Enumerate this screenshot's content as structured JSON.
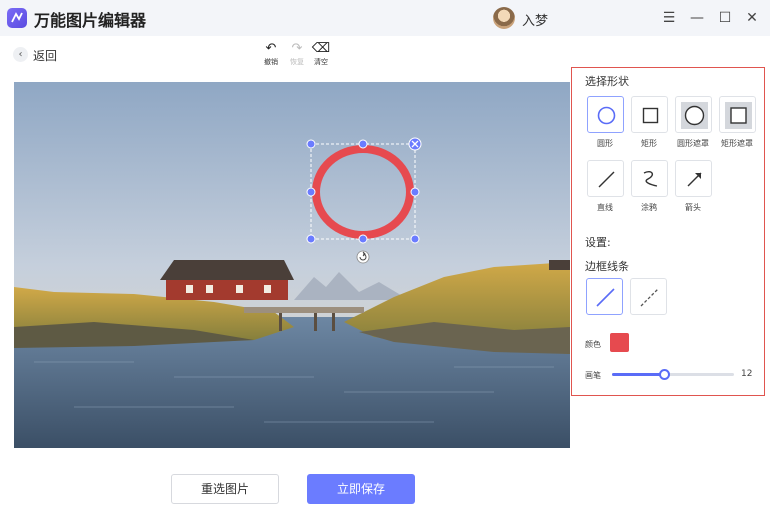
{
  "app": {
    "title": "万能图片编辑器",
    "username": "入梦"
  },
  "window_controls": {
    "menu": "☰",
    "minimize": "—",
    "maximize": "☐",
    "close": "✕"
  },
  "nav": {
    "back_label": "返回"
  },
  "toolbar": {
    "undo_label": "撤销",
    "undo_icon": "↶",
    "redo_label": "恢复",
    "redo_icon": "↷",
    "redo_enabled": false,
    "clear_label": "清空",
    "clear_icon": "⌫"
  },
  "panel": {
    "shape_heading": "选择形状",
    "shapes": [
      {
        "label": "圆形",
        "icon": "circle-icon",
        "selected": true
      },
      {
        "label": "矩形",
        "icon": "rectangle-icon",
        "selected": false
      },
      {
        "label": "圆形遮罩",
        "icon": "circle-mask-icon",
        "selected": false
      },
      {
        "label": "矩形遮罩",
        "icon": "rectangle-mask-icon",
        "selected": false
      },
      {
        "label": "直线",
        "icon": "line-icon",
        "selected": false
      },
      {
        "label": "涂鸦",
        "icon": "scribble-icon",
        "selected": false
      },
      {
        "label": "箭头",
        "icon": "arrow-icon",
        "selected": false
      }
    ],
    "settings_heading": "设置:",
    "border_heading": "边框线条",
    "border_styles": [
      {
        "icon": "solid-line-icon",
        "selected": true
      },
      {
        "icon": "dashed-line-icon",
        "selected": false
      }
    ],
    "color_label": "颜色",
    "color_value": "#e64a4f",
    "pen_label": "画笔",
    "pen_value": "12",
    "pen_fraction": 0.43
  },
  "canvas": {
    "shape": "circle",
    "stroke_color": "#e64a4f"
  },
  "actions": {
    "reselect_label": "重选图片",
    "save_label": "立即保存"
  },
  "colors": {
    "accent": "#6b7cff",
    "panel_border": "#e0554f",
    "handle": "#6b7cff"
  }
}
